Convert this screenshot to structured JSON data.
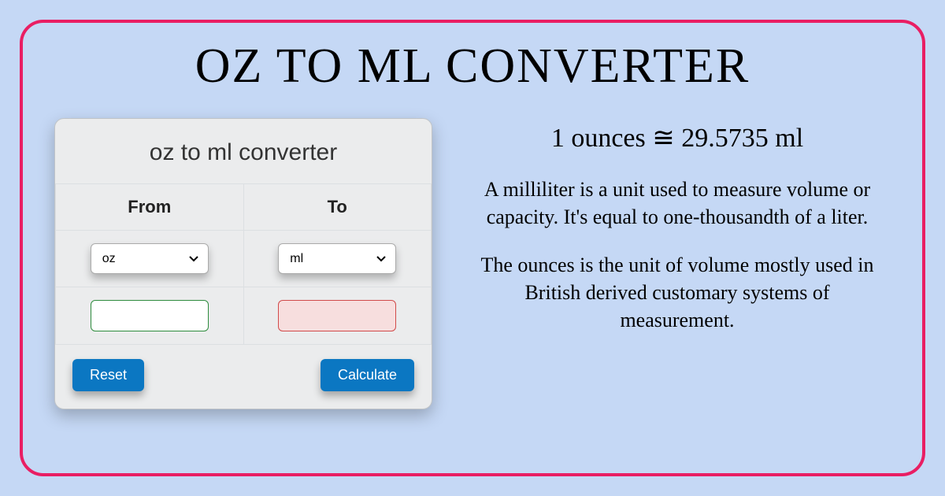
{
  "title": "OZ TO ML CONVERTER",
  "widget": {
    "title": "oz to ml converter",
    "from_label": "From",
    "to_label": "To",
    "from_unit": "oz",
    "to_unit": "ml",
    "from_value": "",
    "to_value": "",
    "reset_label": "Reset",
    "calculate_label": "Calculate"
  },
  "info": {
    "conversion": "1 ounces ≅ 29.5735 ml",
    "para1": "A milliliter is a unit used to measure volume or capacity. It's equal to one-thousandth of a liter.",
    "para2": "The ounces is the unit of volume mostly used in British derived customary systems of measurement."
  }
}
